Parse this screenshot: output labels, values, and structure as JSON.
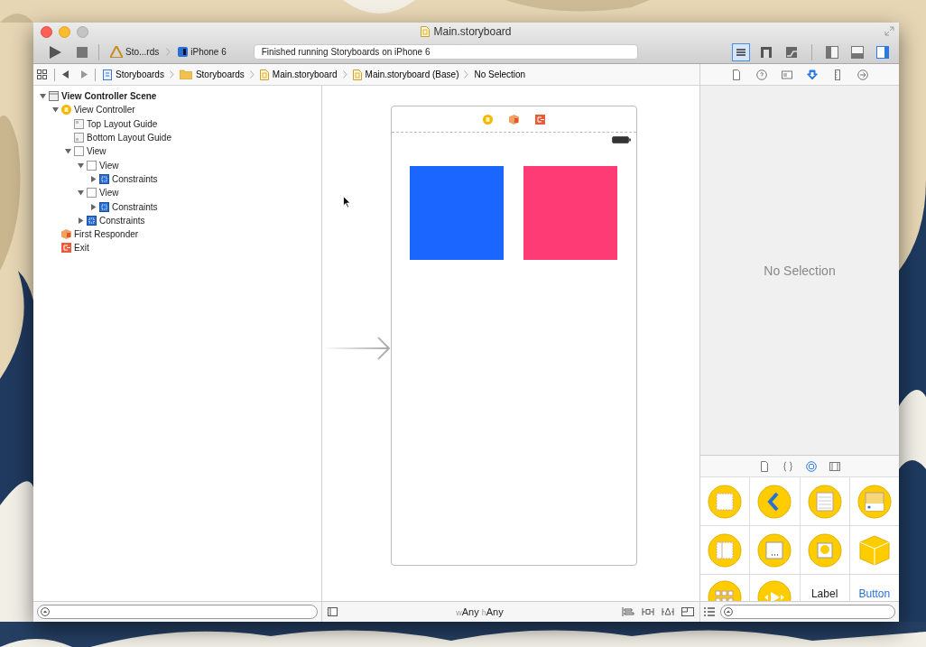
{
  "window": {
    "title": "Main.storyboard"
  },
  "toolbar": {
    "scheme": "Sto...rds",
    "device": "iPhone 6",
    "status": "Finished running Storyboards on iPhone 6",
    "editor_modes": [
      {
        "kind": "standard",
        "selected": true
      },
      {
        "kind": "assistant",
        "selected": false
      },
      {
        "kind": "version",
        "selected": false
      }
    ],
    "panels": [
      {
        "kind": "navigator",
        "on": false
      },
      {
        "kind": "debug",
        "on": false
      },
      {
        "kind": "utilities",
        "on": true
      }
    ]
  },
  "jump_bar": [
    {
      "label": "Storyboards",
      "kind": "project"
    },
    {
      "label": "Storyboards",
      "kind": "folder"
    },
    {
      "label": "Main.storyboard",
      "kind": "file"
    },
    {
      "label": "Main.storyboard (Base)",
      "kind": "file"
    },
    {
      "label": "No Selection",
      "kind": "plain"
    }
  ],
  "outline": [
    {
      "label": "View Controller Scene",
      "kind": "scene",
      "expanded": true,
      "children": [
        {
          "label": "View Controller",
          "kind": "controller",
          "expanded": true,
          "children": [
            {
              "label": "Top Layout Guide",
              "kind": "top-guide"
            },
            {
              "label": "Bottom Layout Guide",
              "kind": "bottom-guide"
            },
            {
              "label": "View",
              "kind": "view",
              "expanded": true,
              "children": [
                {
                  "label": "View",
                  "kind": "view",
                  "expanded": true,
                  "children": [
                    {
                      "label": "Constraints",
                      "kind": "constraints",
                      "expanded": false
                    }
                  ]
                },
                {
                  "label": "View",
                  "kind": "view",
                  "expanded": true,
                  "children": [
                    {
                      "label": "Constraints",
                      "kind": "constraints",
                      "expanded": false
                    }
                  ]
                },
                {
                  "label": "Constraints",
                  "kind": "constraints",
                  "expanded": false
                }
              ]
            }
          ]
        },
        {
          "label": "First Responder",
          "kind": "responder"
        },
        {
          "label": "Exit",
          "kind": "exit"
        }
      ]
    }
  ],
  "canvas": {
    "views": [
      {
        "color": "#1a66ff"
      },
      {
        "color": "#ff3b75"
      }
    ],
    "size_class": {
      "w_prefix": "w",
      "w": "Any",
      "h_prefix": "h",
      "h": "Any"
    }
  },
  "inspector": {
    "tabs": [
      {
        "kind": "file",
        "selected": false
      },
      {
        "kind": "help",
        "selected": false
      },
      {
        "kind": "identity",
        "selected": false
      },
      {
        "kind": "attributes",
        "selected": true
      },
      {
        "kind": "size",
        "selected": false
      },
      {
        "kind": "connections",
        "selected": false
      }
    ],
    "message": "No Selection"
  },
  "library": {
    "tabs": [
      {
        "kind": "file",
        "selected": false
      },
      {
        "kind": "code",
        "selected": false
      },
      {
        "kind": "object",
        "selected": true
      },
      {
        "kind": "media",
        "selected": false
      }
    ],
    "items": [
      {
        "kind": "view-controller"
      },
      {
        "kind": "navigation-controller"
      },
      {
        "kind": "table-controller"
      },
      {
        "kind": "tab-controller"
      },
      {
        "kind": "split-controller"
      },
      {
        "kind": "page-controller"
      },
      {
        "kind": "glkit-controller"
      },
      {
        "kind": "object"
      },
      {
        "kind": "collection-controller"
      },
      {
        "kind": "player-controller"
      },
      {
        "kind": "label",
        "label": "Label"
      },
      {
        "kind": "button",
        "label": "Button"
      }
    ]
  }
}
